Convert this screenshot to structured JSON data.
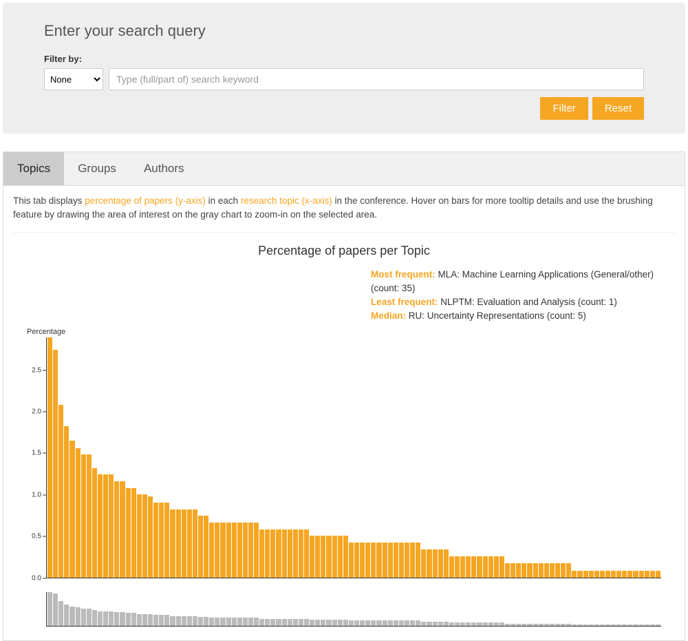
{
  "search": {
    "title": "Enter your search query",
    "filter_label": "Filter by:",
    "select_value": "None",
    "keyword_placeholder": "Type (full/part of) search keyword",
    "filter_btn": "Filter",
    "reset_btn": "Reset"
  },
  "tabs": {
    "items": [
      {
        "label": "Topics",
        "active": true
      },
      {
        "label": "Groups",
        "active": false
      },
      {
        "label": "Authors",
        "active": false
      }
    ]
  },
  "desc": {
    "p1": "This tab displays ",
    "hl1": "percentage of papers (y-axis)",
    "p2": " in each ",
    "hl2": "research topic (x-axis)",
    "p3": " in the conference. Hover on bars for more tooltip details and use the brushing feature by drawing the area of interest on the gray chart to zoom-in on the selected area."
  },
  "chart_title": "Percentage of papers per Topic",
  "stats": {
    "most_label": "Most frequent:",
    "most_value": " MLA: Machine Learning Applications (General/other) (count: 35)",
    "least_label": "Least frequent:",
    "least_value": " NLPTM: Evaluation and Analysis (count: 1)",
    "median_label": "Median:",
    "median_value": " RU: Uncertainty Representations (count: 5)"
  },
  "y_axis_title": "Percentage",
  "chart_data": {
    "type": "bar",
    "title": "Percentage of papers per Topic",
    "xlabel": "research topic",
    "ylabel": "Percentage",
    "ylim": [
      0,
      2.9
    ],
    "yticks": [
      0.0,
      0.5,
      1.0,
      1.5,
      2.0,
      2.5
    ],
    "values": [
      2.9,
      2.75,
      2.08,
      1.82,
      1.65,
      1.56,
      1.48,
      1.48,
      1.32,
      1.24,
      1.24,
      1.24,
      1.16,
      1.16,
      1.08,
      1.08,
      1.0,
      1.0,
      0.98,
      0.9,
      0.9,
      0.9,
      0.82,
      0.82,
      0.82,
      0.82,
      0.82,
      0.74,
      0.74,
      0.66,
      0.66,
      0.66,
      0.66,
      0.66,
      0.66,
      0.66,
      0.66,
      0.66,
      0.58,
      0.58,
      0.58,
      0.58,
      0.58,
      0.58,
      0.58,
      0.58,
      0.58,
      0.5,
      0.5,
      0.5,
      0.5,
      0.5,
      0.5,
      0.5,
      0.42,
      0.42,
      0.42,
      0.42,
      0.42,
      0.42,
      0.42,
      0.42,
      0.42,
      0.42,
      0.42,
      0.42,
      0.42,
      0.34,
      0.34,
      0.34,
      0.34,
      0.34,
      0.25,
      0.25,
      0.25,
      0.25,
      0.25,
      0.25,
      0.25,
      0.25,
      0.25,
      0.25,
      0.17,
      0.17,
      0.17,
      0.17,
      0.17,
      0.17,
      0.17,
      0.17,
      0.17,
      0.17,
      0.17,
      0.17,
      0.08,
      0.08,
      0.08,
      0.08,
      0.08,
      0.08,
      0.08,
      0.08,
      0.08,
      0.08,
      0.08,
      0.08,
      0.08,
      0.08,
      0.08,
      0.08
    ],
    "brush_opacity": "gray overview below main chart with identical distribution",
    "most_frequent": {
      "topic": "MLA: Machine Learning Applications (General/other)",
      "count": 35
    },
    "least_frequent": {
      "topic": "NLPTM: Evaluation and Analysis",
      "count": 1
    },
    "median": {
      "topic": "RU: Uncertainty Representations",
      "count": 5
    }
  }
}
